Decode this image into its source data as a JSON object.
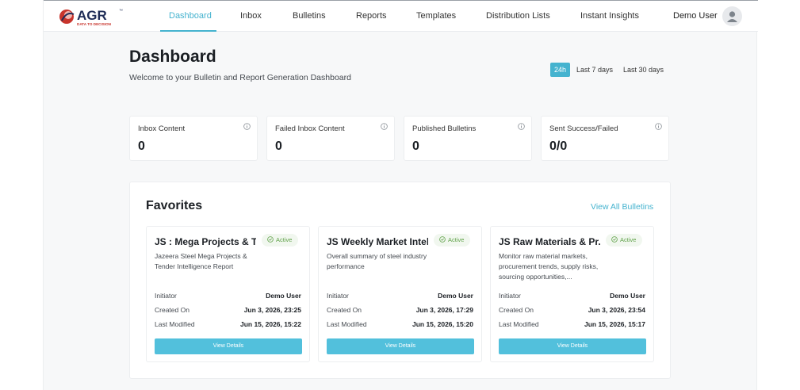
{
  "logo": {
    "brand": "AGR",
    "tagline": "DATA TO DECISION",
    "trademark": "™"
  },
  "nav": {
    "items": [
      {
        "label": "Dashboard",
        "active": true
      },
      {
        "label": "Inbox"
      },
      {
        "label": "Bulletins"
      },
      {
        "label": "Reports"
      },
      {
        "label": "Templates"
      },
      {
        "label": "Distribution Lists"
      },
      {
        "label": "Instant Insights"
      }
    ],
    "user_name": "Demo User",
    "avatar_icon": "user-avatar-icon"
  },
  "header": {
    "title": "Dashboard",
    "subtitle": "Welcome to your Bulletin and Report Generation Dashboard"
  },
  "time_ranges": [
    {
      "label": "24h",
      "active": true
    },
    {
      "label": "Last 7 days"
    },
    {
      "label": "Last 30 days"
    }
  ],
  "stats": [
    {
      "label": "Inbox Content",
      "value": "0"
    },
    {
      "label": "Failed Inbox Content",
      "value": "0"
    },
    {
      "label": "Published Bulletins",
      "value": "0"
    },
    {
      "label": "Sent Success/Failed",
      "value": "0/0"
    }
  ],
  "favorites": {
    "title": "Favorites",
    "view_all": "View All Bulletins",
    "cards": [
      {
        "title": "JS : Mega Projects & T...",
        "status": "Active",
        "description": "Jazeera Steel Mega Projects & Tender Intelligence Report",
        "initiator_label": "Initiator",
        "initiator": "Demo User",
        "created_label": "Created On",
        "created": "Jun 3, 2026, 23:25",
        "modified_label": "Last Modified",
        "modified": "Jun 15, 2026, 15:22",
        "button": "View Details"
      },
      {
        "title": "JS Weekly Market Intel...",
        "status": "Active",
        "description": "Overall summary of steel industry performance",
        "initiator_label": "Initiator",
        "initiator": "Demo User",
        "created_label": "Created On",
        "created": "Jun 3, 2026, 17:29",
        "modified_label": "Last Modified",
        "modified": "Jun 15, 2026, 15:20",
        "button": "View Details"
      },
      {
        "title": "JS Raw Materials & Pr...",
        "status": "Active",
        "description": "Monitor raw material markets, procurement trends, supply risks, sourcing opportunities,...",
        "initiator_label": "Initiator",
        "initiator": "Demo User",
        "created_label": "Created On",
        "created": "Jun 3, 2026, 23:54",
        "modified_label": "Last Modified",
        "modified": "Jun 15, 2026, 15:17",
        "button": "View Details"
      }
    ]
  },
  "colors": {
    "accent": "#45b3cf",
    "button": "#52c0dc",
    "active_badge": "#61a24a",
    "logo_red": "#c8342c",
    "logo_navy": "#1f2d57"
  }
}
